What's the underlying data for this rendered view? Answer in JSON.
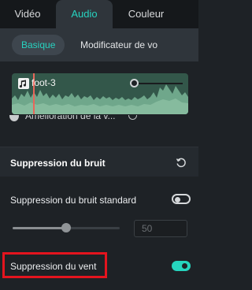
{
  "tabs": [
    {
      "label": "Vidéo",
      "active": false
    },
    {
      "label": "Audio",
      "active": true
    },
    {
      "label": "Couleur",
      "active": false
    }
  ],
  "subtabs": [
    {
      "label": "Basique",
      "active": true
    },
    {
      "label": "Modificateur de vo",
      "active": false
    }
  ],
  "clip": {
    "name": "foot-3",
    "icon": "music-note-icon"
  },
  "enhancement": {
    "label": "Amélioration de la v...",
    "enabled": false
  },
  "noise_section": {
    "title": "Suppression du bruit",
    "reset_icon": "reset-icon"
  },
  "standard_noise": {
    "label": "Suppression du bruit standard",
    "enabled": false,
    "level": 50,
    "level_text": "50"
  },
  "wind": {
    "label": "Suppression du vent",
    "enabled": true
  },
  "colors": {
    "accent": "#27d3c0",
    "highlight": "#e4141e",
    "wave_bg": "#33574a"
  }
}
